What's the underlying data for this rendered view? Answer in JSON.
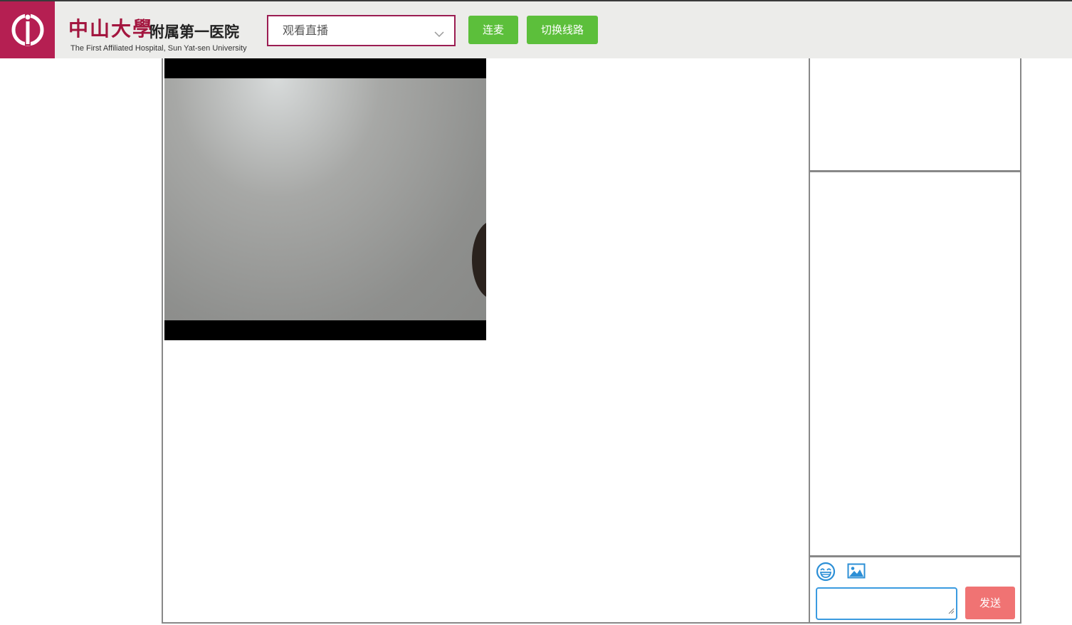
{
  "header": {
    "logo_name": "sysu-hospital-logo",
    "brand_cn": "中山大學",
    "brand_cn_secondary": "附属第一医院",
    "brand_en": "The First Affiliated Hospital, Sun Yat-sen University",
    "mode_select": {
      "value": "观看直播",
      "icon": "chevron-down-icon"
    },
    "connect_mic_button": "连麦",
    "switch_line_button": "切换线路"
  },
  "colors": {
    "brand": "#b51f52",
    "select_border": "#9b1d52",
    "button_green": "#5cbf3b",
    "send_button": "#f07373",
    "input_focus": "#3b9be0"
  },
  "chat": {
    "emoji_icon": "emoji-icon",
    "image_icon": "image-icon",
    "input_value": "",
    "send_button": "发送"
  }
}
